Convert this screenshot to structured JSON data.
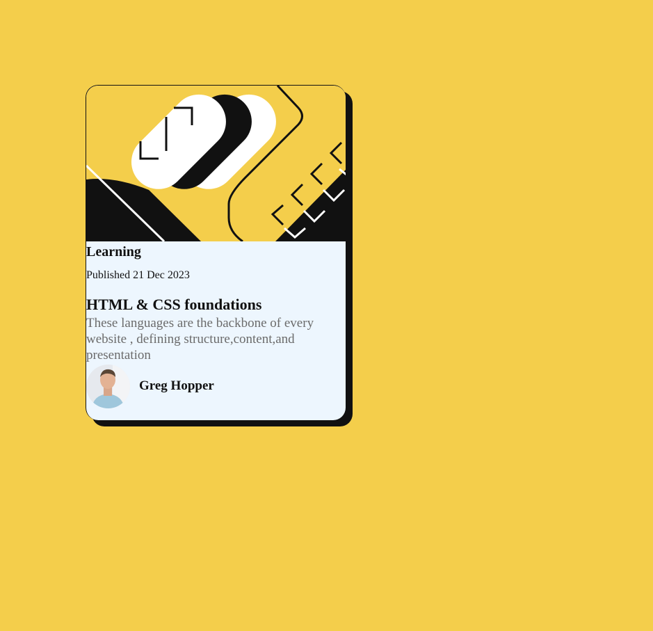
{
  "page": {
    "background_color": "#F4CE4B"
  },
  "card": {
    "background_color": "#EDF6FE",
    "shadow_color": "#111111",
    "category": "Learning",
    "published": "Published 21 Dec 2023",
    "title": "HTML & CSS foundations",
    "description": "These languages are the backbone of every website , defining structure,content,and presentation",
    "author": {
      "name": "Greg Hopper"
    }
  }
}
